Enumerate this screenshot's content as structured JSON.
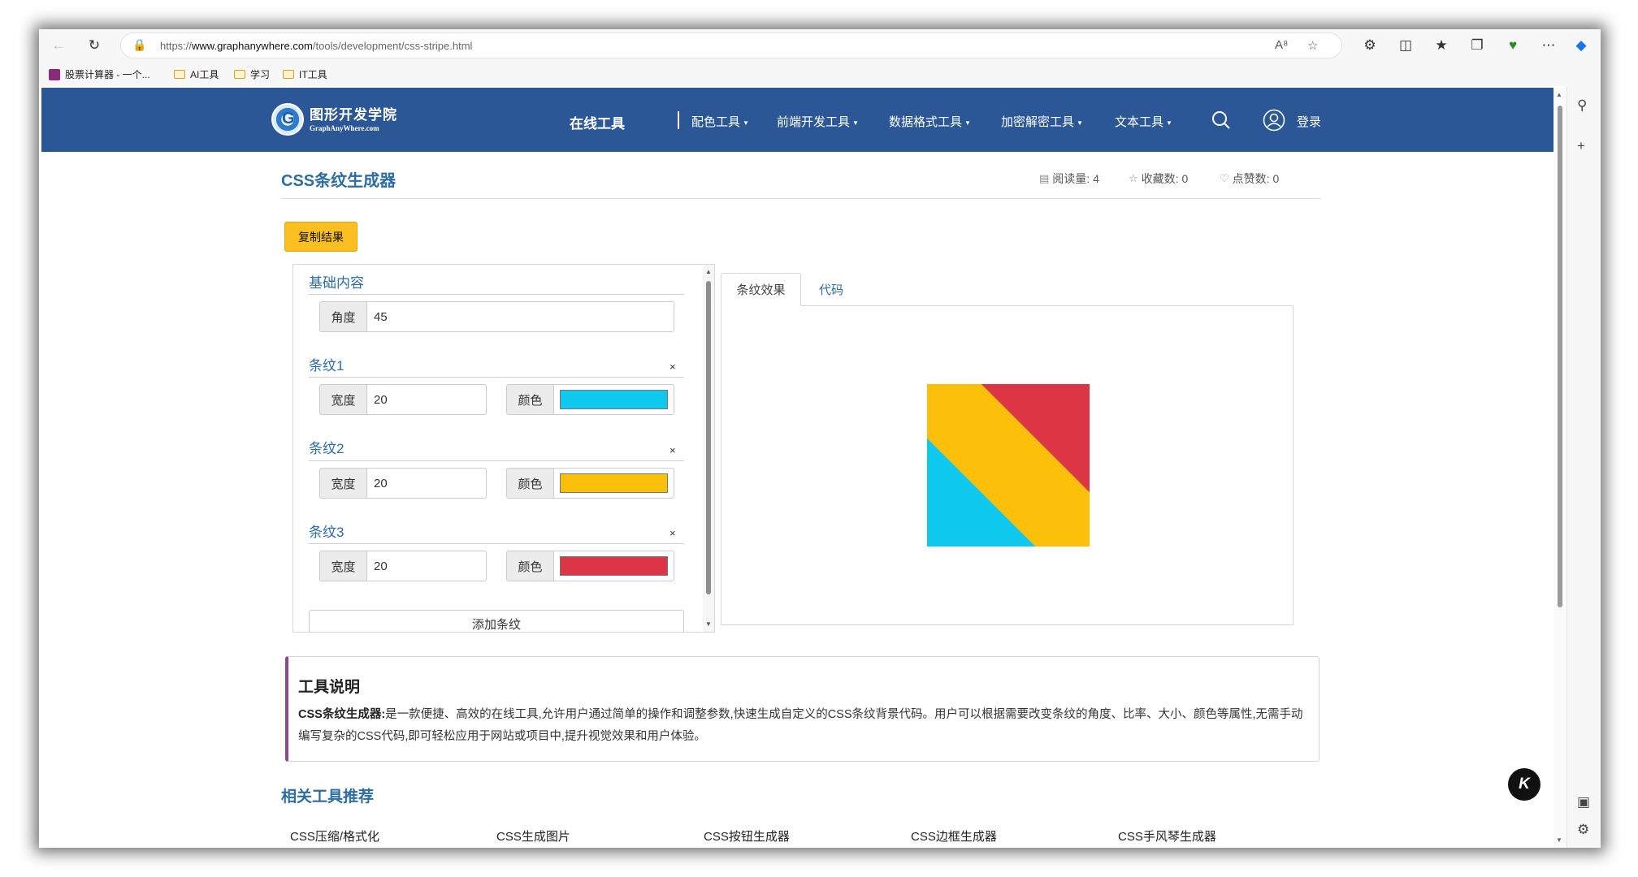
{
  "browser": {
    "url_prefix": "https://",
    "url_host": "www.graphanywhere.com",
    "url_path": "/tools/development/css-stripe.html",
    "bookmarks": [
      "股票计算器 - 一个...",
      "AI工具",
      "学习",
      "IT工具"
    ]
  },
  "site": {
    "logo_title": "图形开发学院",
    "logo_sub": "GraphAnyWhere.com",
    "nav_main": "在线工具",
    "nav_items": [
      "配色工具",
      "前端开发工具",
      "数据格式工具",
      "加密解密工具",
      "文本工具"
    ],
    "login": "登录"
  },
  "page": {
    "title": "CSS条纹生成器",
    "stats": {
      "read_label": "阅读量:",
      "read_value": "4",
      "fav_label": "收藏数:",
      "fav_value": "0",
      "like_label": "点赞数:",
      "like_value": "0"
    },
    "copy_button": "复制结果"
  },
  "panel": {
    "base_title": "基础内容",
    "angle_label": "角度",
    "angle_value": "45",
    "width_label": "宽度",
    "color_label": "颜色",
    "close": "×",
    "stripes": [
      {
        "title": "条纹1",
        "width": "20",
        "color": "#0ec8ee"
      },
      {
        "title": "条纹2",
        "width": "20",
        "color": "#fbbf0a"
      },
      {
        "title": "条纹3",
        "width": "20",
        "color": "#dc3545"
      }
    ],
    "add_button": "添加条纹"
  },
  "preview": {
    "tab_effect": "条纹效果",
    "tab_code": "代码"
  },
  "description": {
    "title": "工具说明",
    "lead": "CSS条纹生成器:",
    "text": "是一款便捷、高效的在线工具,允许用户通过简单的操作和调整参数,快速生成自定义的CSS条纹背景代码。用户可以根据需要改变条纹的角度、比率、大小、颜色等属性,无需手动编写复杂的CSS代码,即可轻松应用于网站或项目中,提升视觉效果和用户体验。"
  },
  "related": {
    "title": "相关工具推荐",
    "items": [
      "CSS压缩/格式化",
      "CSS生成图片",
      "CSS按钮生成器",
      "CSS边框生成器",
      "CSS手风琴生成器"
    ]
  },
  "badge": "K",
  "colors": {
    "navbar": "#2b5797",
    "link": "#2e6da4",
    "button": "#fbbf22",
    "accent_border": "#8b4a8e"
  }
}
